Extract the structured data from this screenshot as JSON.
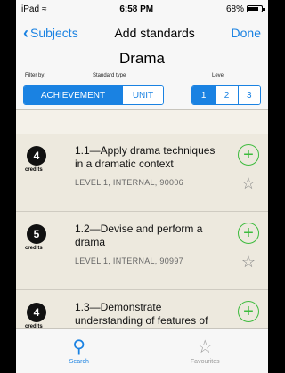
{
  "status": {
    "carrier": "iPad",
    "time": "6:58 PM",
    "battery": "68%"
  },
  "nav": {
    "back_label": "Subjects",
    "title": "Add standards",
    "done_label": "Done"
  },
  "subject": "Drama",
  "filters": {
    "filter_by_label": "Filter by:",
    "type_label": "Standard type",
    "level_label": "Level",
    "types": [
      "ACHIEVEMENT",
      "UNIT"
    ],
    "selected_type": "ACHIEVEMENT",
    "levels": [
      "1",
      "2",
      "3"
    ],
    "selected_level": "1"
  },
  "credits_word": "credits",
  "standards": [
    {
      "credits": "4",
      "title": "1.1—Apply drama techniques in a dramatic context",
      "meta": "LEVEL 1, INTERNAL, 90006"
    },
    {
      "credits": "5",
      "title": "1.2—Devise and perform a drama",
      "meta": "LEVEL 1, INTERNAL, 90997"
    },
    {
      "credits": "4",
      "title": "1.3—Demonstrate understanding of features of",
      "meta": ""
    }
  ],
  "tabs": {
    "search_label": "Search",
    "favourites_label": "Favourites"
  },
  "colors": {
    "accent": "#1a82e2",
    "add_green": "#3dbb3d",
    "card_bg": "#ede9de"
  }
}
